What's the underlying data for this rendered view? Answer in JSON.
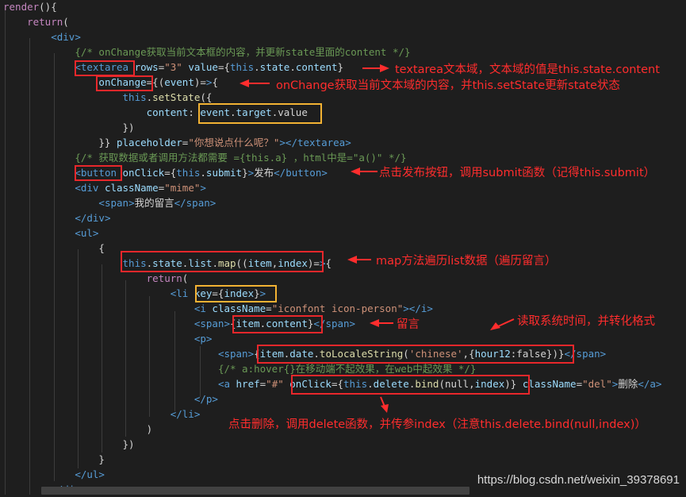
{
  "code_lines": [
    "render(){",
    "    return(",
    "        <div>",
    "            {/* onChange获取当前文本框的内容，并更新state里面的content */}",
    "            <textarea rows=\"3\" value={this.state.content}",
    "                onChange={(event)=>{",
    "                    this.setState({",
    "                        content: event.target.value",
    "                    })",
    "                }} placeholder=\"你想说点什么呢？\"></textarea>",
    "            {/* 获取数据或者调用方法都需要 ={this.a} ，html中是=\"a()\" */}",
    "            <button onClick={this.submit}>发布</button>",
    "            <div className=\"mime\">",
    "                <span>我的留言</span>",
    "            </div>",
    "            <ul>",
    "                {",
    "                    this.state.list.map((item,index)=>{",
    "                        return(",
    "                            <li key={index}>",
    "                                <i className=\"iconfont icon-person\"></i>",
    "                                <span>{item.content}</span>",
    "                                <p>",
    "                                    <span>{item.date.toLocaleString('chinese',{hour12:false})}</span>",
    "                                    {/* a:hover{}在移动端不起效果，在web中起效果 */}",
    "                                    <a href=\"#\" onClick={this.delete.bind(null,index)} className=\"del\">删除</a>",
    "                                </p>",
    "                            </li>",
    "                        )",
    "                    })",
    "                }",
    "            </ul>",
    "        </div>"
  ],
  "annotations": {
    "textarea": "textarea文本域，文本域的值是this.state.content",
    "onchange": "onChange获取当前文本域的内容，并this.setState更新state状态",
    "button": "点击发布按钮，调用submit函数（记得this.submit）",
    "map": "map方法遍历list数据（遍历留言）",
    "content": "留言",
    "time": "读取系统时间，并转化格式",
    "delete": "点击删除，调用delete函数，并传参index（注意this.delete.bind(null,index)）"
  },
  "watermark": "https://blog.csdn.net/weixin_39378691",
  "colors": {
    "background": "#1e1e1e",
    "highlight_red": "#e8272b",
    "highlight_yellow": "#f2b233",
    "annotation_text": "#ff2d2d"
  }
}
